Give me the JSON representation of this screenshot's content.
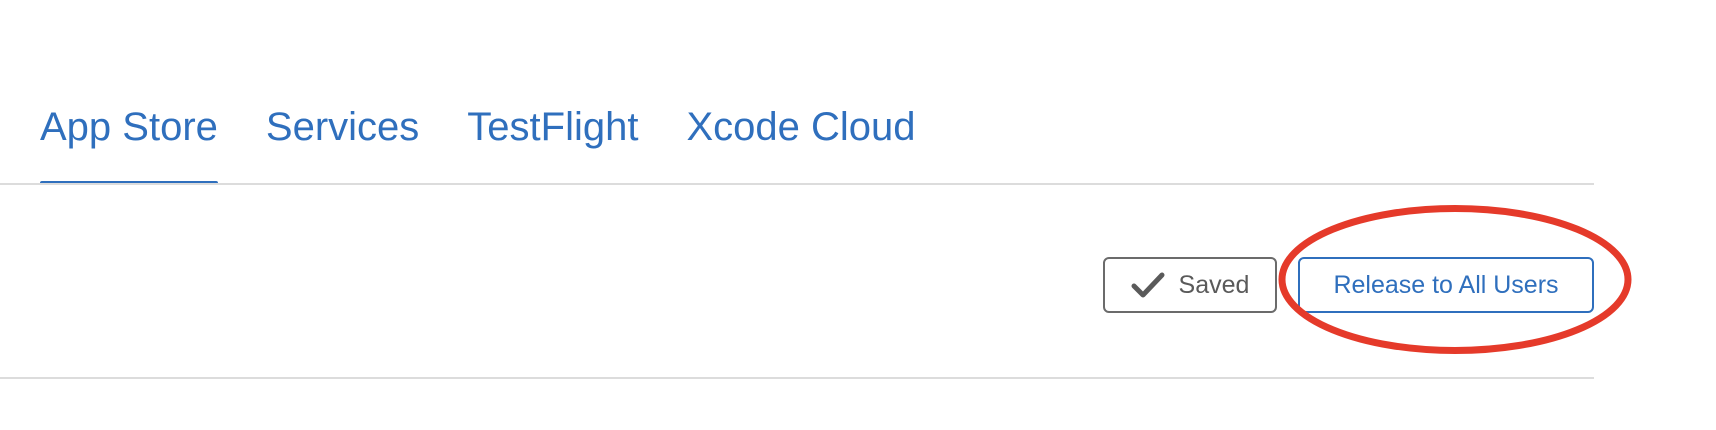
{
  "tabs": [
    {
      "label": "App Store",
      "active": true
    },
    {
      "label": "Services",
      "active": false
    },
    {
      "label": "TestFlight",
      "active": false
    },
    {
      "label": "Xcode Cloud",
      "active": false
    }
  ],
  "toolbar": {
    "saved_label": "Saved",
    "saved_icon": "checkmark-icon",
    "release_label": "Release to All Users"
  },
  "annotation": {
    "shape": "ellipse",
    "target": "release-to-all-users-button",
    "color": "#e53a2a"
  },
  "colors": {
    "accent": "#2f6fbd",
    "divider": "#dcdcdc",
    "saved_border": "#6b6b6b",
    "saved_text": "#5a5a5a"
  }
}
